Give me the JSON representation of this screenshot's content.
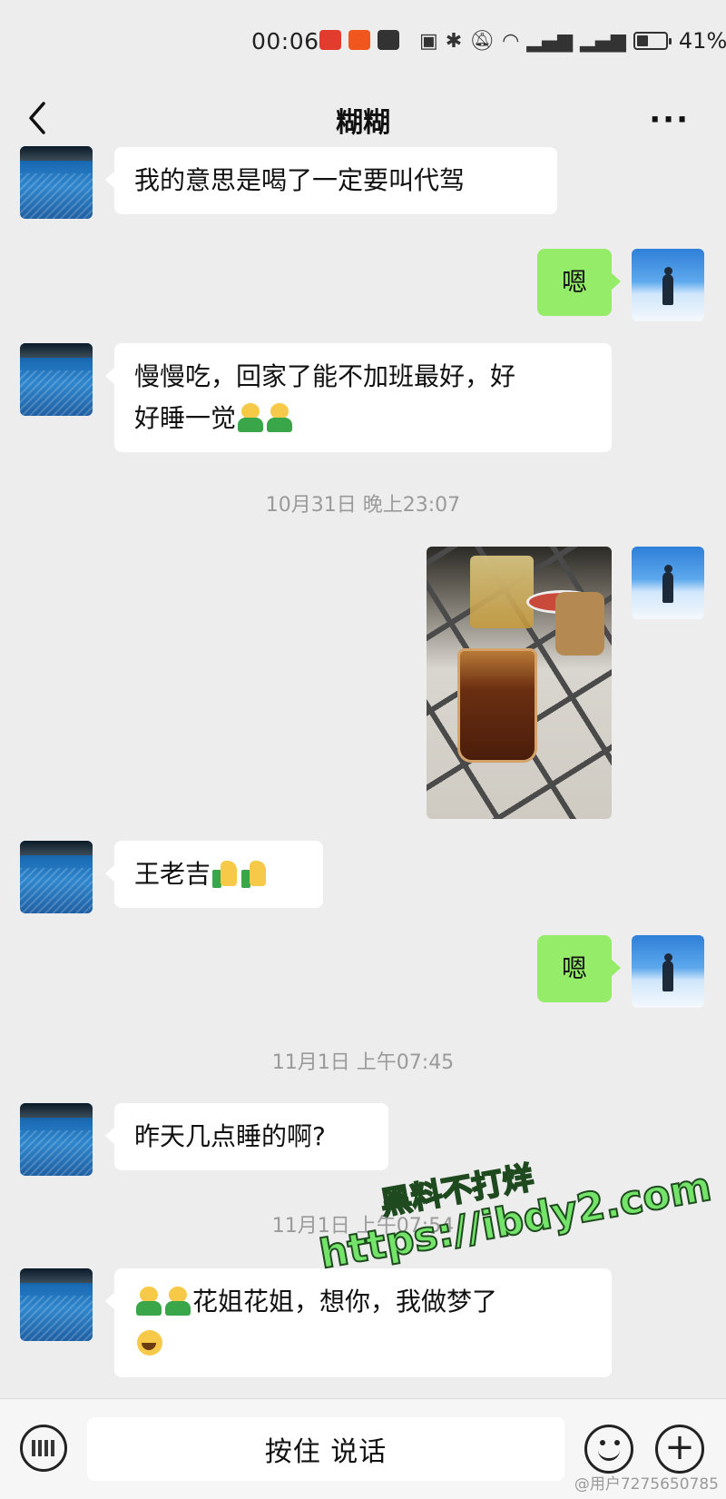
{
  "status_bar": {
    "time": "00:06",
    "battery_percent": "41%",
    "battery_level": 0.41
  },
  "header": {
    "title": "糊糊",
    "back_icon": "chevron-left-icon",
    "more_icon": "more-dots-icon",
    "more_label": "···"
  },
  "messages": [
    {
      "side": "left",
      "text": "我的意思是喝了一定要叫代驾"
    },
    {
      "side": "right",
      "text": "嗯"
    },
    {
      "side": "left",
      "text_line1": "慢慢吃，回家了能不加班最好，好",
      "text_line2": "好睡一觉"
    },
    {
      "timestamp": "10月31日 晚上23:07"
    },
    {
      "side": "right",
      "type": "image"
    },
    {
      "side": "left",
      "text": "王老吉"
    },
    {
      "side": "right",
      "text": "嗯"
    },
    {
      "timestamp": "11月1日 上午07:45"
    },
    {
      "side": "left",
      "text": "昨天几点睡的啊?"
    },
    {
      "timestamp": "11月1日 上午07:54"
    },
    {
      "side": "left",
      "text_line1": "花姐花姐，想你，我做梦了"
    }
  ],
  "watermark": {
    "line1": "黑料不打烊",
    "line2": "https://ibdy2.com"
  },
  "input_bar": {
    "keyboard_icon": "keyboard-icon",
    "hold_to_talk_label": "按住 说话",
    "emoji_icon": "emoji-icon",
    "plus_icon": "plus-icon"
  },
  "footer_mark": "@用户7275650785",
  "colors": {
    "background": "#ededed",
    "sent_bubble": "#95ec69",
    "received_bubble": "#ffffff",
    "timestamp_text": "#9a9a9a"
  }
}
